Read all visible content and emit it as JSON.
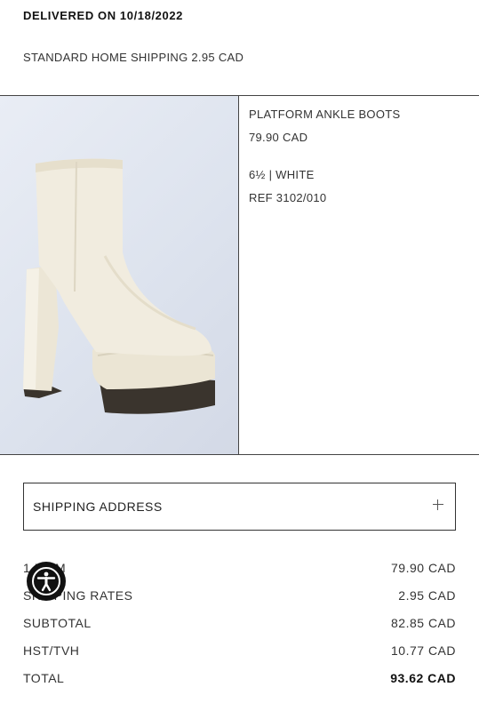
{
  "order": {
    "delivered_label": "DELIVERED ON 10/18/2022",
    "shipping_method": "STANDARD HOME SHIPPING 2.95 CAD"
  },
  "product": {
    "name": "PLATFORM ANKLE BOOTS",
    "price": "79.90 CAD",
    "variant": "6½ | WHITE",
    "ref": "REF 3102/010"
  },
  "shipping_address": {
    "label": "SHIPPING ADDRESS"
  },
  "summary": {
    "item_label": "1 ITEM",
    "item_value": "79.90 CAD",
    "shipping_label": "SHIPPING RATES",
    "shipping_value": "2.95 CAD",
    "subtotal_label": "SUBTOTAL",
    "subtotal_value": "82.85 CAD",
    "tax_label": "HST/TVH",
    "tax_value": "10.77 CAD",
    "total_label": "TOTAL",
    "total_value": "93.62 CAD"
  },
  "icons": {
    "expand": "plus-icon",
    "accessibility": "accessibility-icon"
  },
  "colors": {
    "text": "#222222",
    "divider": "#444444",
    "accessibility_button": "#111111"
  }
}
